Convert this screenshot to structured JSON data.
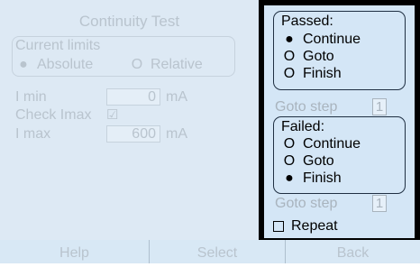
{
  "left_panel": {
    "title": "Continuity Test",
    "current_limits": {
      "label": "Current limits",
      "options": [
        "Absolute",
        "Relative"
      ],
      "selected": "Absolute"
    },
    "i_min": {
      "label": "I min",
      "value": "0",
      "unit": "mA"
    },
    "check_imax": {
      "label": "Check Imax",
      "checked": true,
      "glyph": "☑"
    },
    "i_max": {
      "label": "I max",
      "value": "600",
      "unit": "mA"
    }
  },
  "right_panel": {
    "passed": {
      "label": "Passed:",
      "options": [
        "Continue",
        "Goto",
        "Finish"
      ],
      "selected": "Continue"
    },
    "passed_goto": {
      "label": "Goto step",
      "value": "1"
    },
    "failed": {
      "label": "Failed:",
      "options": [
        "Continue",
        "Goto",
        "Finish"
      ],
      "selected": "Finish"
    },
    "failed_goto": {
      "label": "Goto step",
      "value": "1"
    },
    "repeat": {
      "label": "Repeat",
      "checked": false
    }
  },
  "footer": {
    "help": "Help",
    "select": "Select",
    "back": "Back"
  },
  "glyphs": {
    "radio_on": "●",
    "radio_off": "O"
  },
  "colors": {
    "left_bg": "#dde9f4",
    "right_bg": "#d4e6f6",
    "frame": "#000000",
    "disabled_text": "#b9c4ce"
  }
}
